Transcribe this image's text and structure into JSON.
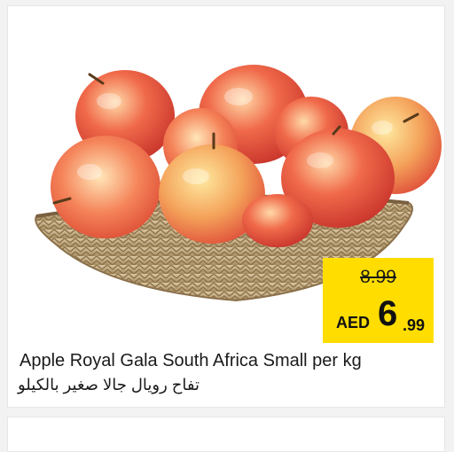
{
  "product": {
    "name_en": "Apple Royal Gala South Africa Small per kg",
    "name_ar": "تفاح رويال جالا صغير بالكيلو",
    "image_icon": "apple-basket-icon"
  },
  "price": {
    "old": "8.99",
    "currency": "AED",
    "new_int": "6",
    "new_dec": ".99"
  },
  "colors": {
    "price_tag": "#ffdd00",
    "card_bg": "#ffffff",
    "page_bg": "#f2f2f2"
  }
}
